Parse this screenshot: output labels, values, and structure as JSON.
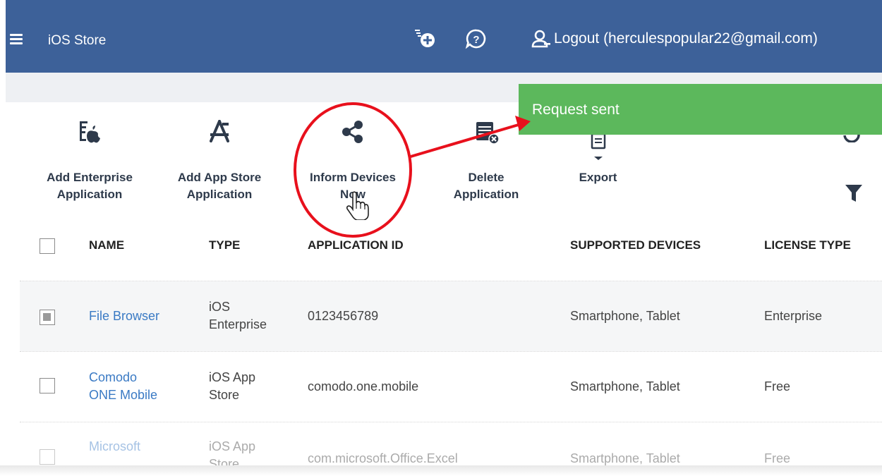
{
  "header": {
    "title": "iOS Store",
    "logout_label": "Logout (herculespopular22@gmail.com)",
    "colors": {
      "bar": "#3d6199",
      "toast": "#5cb85c",
      "link": "#3a7ac4",
      "annotation": "#e8101c"
    }
  },
  "toast": {
    "message": "Request sent"
  },
  "toolbar": {
    "add_enterprise": [
      "Add Enterprise",
      "Application"
    ],
    "add_app_store": [
      "Add App Store",
      "Application"
    ],
    "inform_devices": [
      "Inform Devices",
      "Now"
    ],
    "delete_application": [
      "Delete",
      "Application"
    ],
    "export": "Export"
  },
  "table": {
    "columns": [
      "NAME",
      "TYPE",
      "APPLICATION ID",
      "SUPPORTED DEVICES",
      "LICENSE TYPE"
    ],
    "rows": [
      {
        "name": [
          "File Browser"
        ],
        "type": [
          "iOS",
          "Enterprise"
        ],
        "app_id": "0123456789",
        "devices": "Smartphone, Tablet",
        "license": "Enterprise",
        "checked": true
      },
      {
        "name": [
          "Comodo",
          "ONE Mobile"
        ],
        "type": [
          "iOS App",
          "Store"
        ],
        "app_id": "comodo.one.mobile",
        "devices": "Smartphone, Tablet",
        "license": "Free",
        "checked": false
      },
      {
        "name": [
          "Microsoft"
        ],
        "type": [
          "iOS App",
          "Store"
        ],
        "app_id": "com.microsoft.Office.Excel",
        "devices": "Smartphone, Tablet",
        "license": "Free",
        "checked": false
      }
    ]
  }
}
